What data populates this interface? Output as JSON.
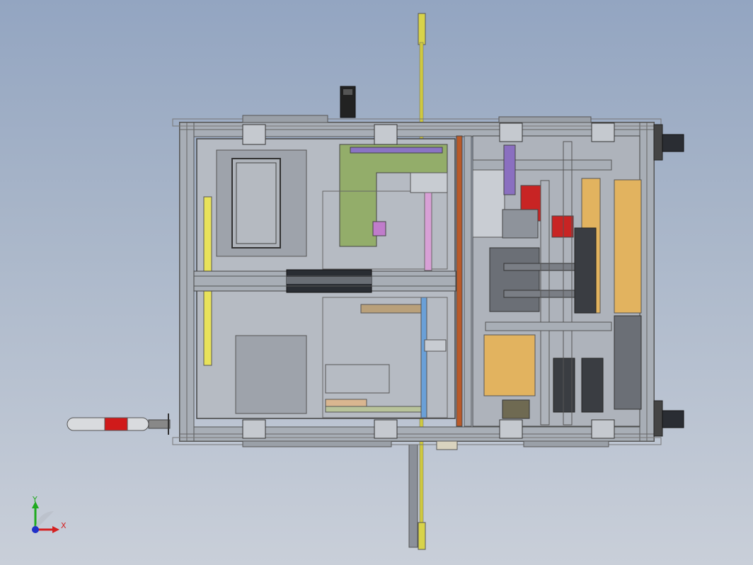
{
  "viewport": {
    "background_top": "#93a5c1",
    "background_bottom": "#c9cfd9"
  },
  "triad": {
    "x_label": "X",
    "y_label": "Y",
    "x_color": "#d42020",
    "y_color": "#1faa1f",
    "z_color": "#2030c8"
  },
  "model": {
    "frame_color": "#a7adb5",
    "panel_color": "#b9bec6",
    "accent_colors": {
      "orange_rail": "#b95a2a",
      "green_bracket": "#8fa864",
      "purple_bar": "#8a6fc0",
      "tan_panel": "#e2b35f",
      "red_block": "#c82424",
      "yellow_rail": "#e6e04a"
    }
  }
}
